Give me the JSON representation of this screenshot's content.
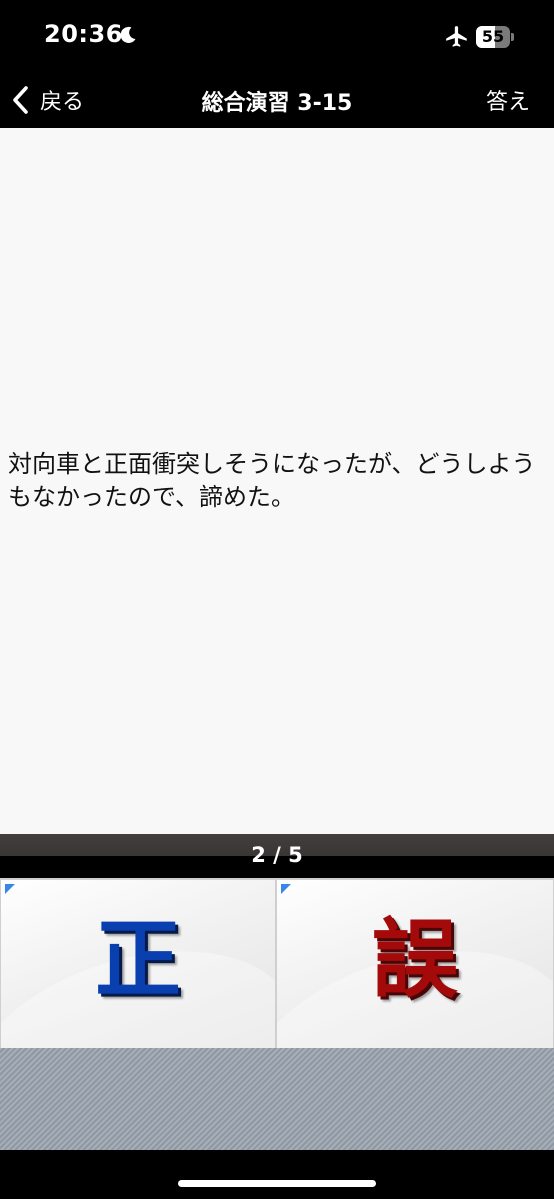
{
  "status_bar": {
    "time": "20:36",
    "battery_level": "55",
    "battery_fraction": 0.55
  },
  "nav": {
    "back_label": "戻る",
    "title": "総合演習 3-15",
    "answer_label": "答え"
  },
  "question": {
    "text": "対向車と正面衝突しそうになったが、どうしようもなかったので、諦めた。"
  },
  "progress": {
    "text": "2 / 5"
  },
  "choices": {
    "correct_glyph": "正",
    "wrong_glyph": "誤"
  },
  "colors": {
    "correct": "#0a3fb0",
    "wrong": "#a40a0a",
    "corner_mark": "#3a86e8"
  },
  "icons": {
    "moon": "moon-icon",
    "airplane": "airplane-icon",
    "back": "chevron-left-icon"
  }
}
